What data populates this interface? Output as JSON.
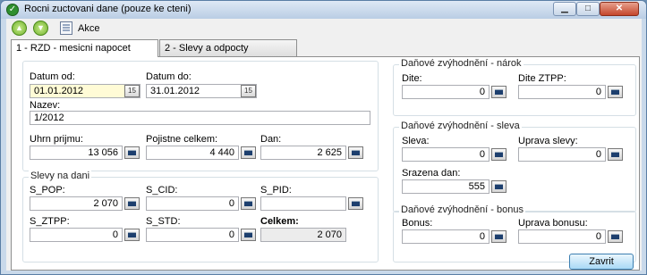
{
  "window": {
    "title": "Rocni zuctovani dane (pouze ke cteni)"
  },
  "toolbar": {
    "akce_label": "Akce"
  },
  "tabs": [
    {
      "label": "1 - RZD - mesicni napocet"
    },
    {
      "label": "2 - Slevy a odpocty"
    }
  ],
  "main": {
    "datum_od": {
      "label": "Datum od:",
      "value": "01.01.2012"
    },
    "datum_do": {
      "label": "Datum do:",
      "value": "31.01.2012"
    },
    "nazev": {
      "label": "Nazev:",
      "value": "1/2012"
    },
    "uhrn_prijmu": {
      "label": "Uhrn prijmu:",
      "value": "13 056"
    },
    "pojistne_celkem": {
      "label": "Pojistne celkem:",
      "value": "4 440"
    },
    "dan": {
      "label": "Dan:",
      "value": "2 625"
    }
  },
  "slevy_na_dani": {
    "title": "Slevy na dani",
    "s_pop": {
      "label": "S_POP:",
      "value": "2 070"
    },
    "s_cid": {
      "label": "S_CID:",
      "value": "0"
    },
    "s_pid": {
      "label": "S_PID:",
      "value": ""
    },
    "s_ztpp": {
      "label": "S_ZTPP:",
      "value": "0"
    },
    "s_std": {
      "label": "S_STD:",
      "value": "0"
    },
    "celkem": {
      "label": "Celkem:",
      "value": "2 070"
    }
  },
  "narok": {
    "title": "Daňové zvýhodnění - nárok",
    "dite": {
      "label": "Dite:",
      "value": "0"
    },
    "dite_ztpp": {
      "label": "Dite ZTPP:",
      "value": "0"
    }
  },
  "sleva": {
    "title": "Daňové zvýhodnění - sleva",
    "sleva": {
      "label": "Sleva:",
      "value": "0"
    },
    "uprava_slevy": {
      "label": "Uprava slevy:",
      "value": "0"
    },
    "srazena_dan": {
      "label": "Srazena dan:",
      "value": "555"
    }
  },
  "bonus": {
    "title": "Daňové zvýhodnění - bonus",
    "bonus": {
      "label": "Bonus:",
      "value": "0"
    },
    "uprava_bonusu": {
      "label": "Uprava bonusu:",
      "value": "0"
    }
  },
  "footer": {
    "zavrit_label": "Zavrit"
  },
  "icons": {
    "calendar": "calendar-icon",
    "calculator": "calculator-icon"
  }
}
